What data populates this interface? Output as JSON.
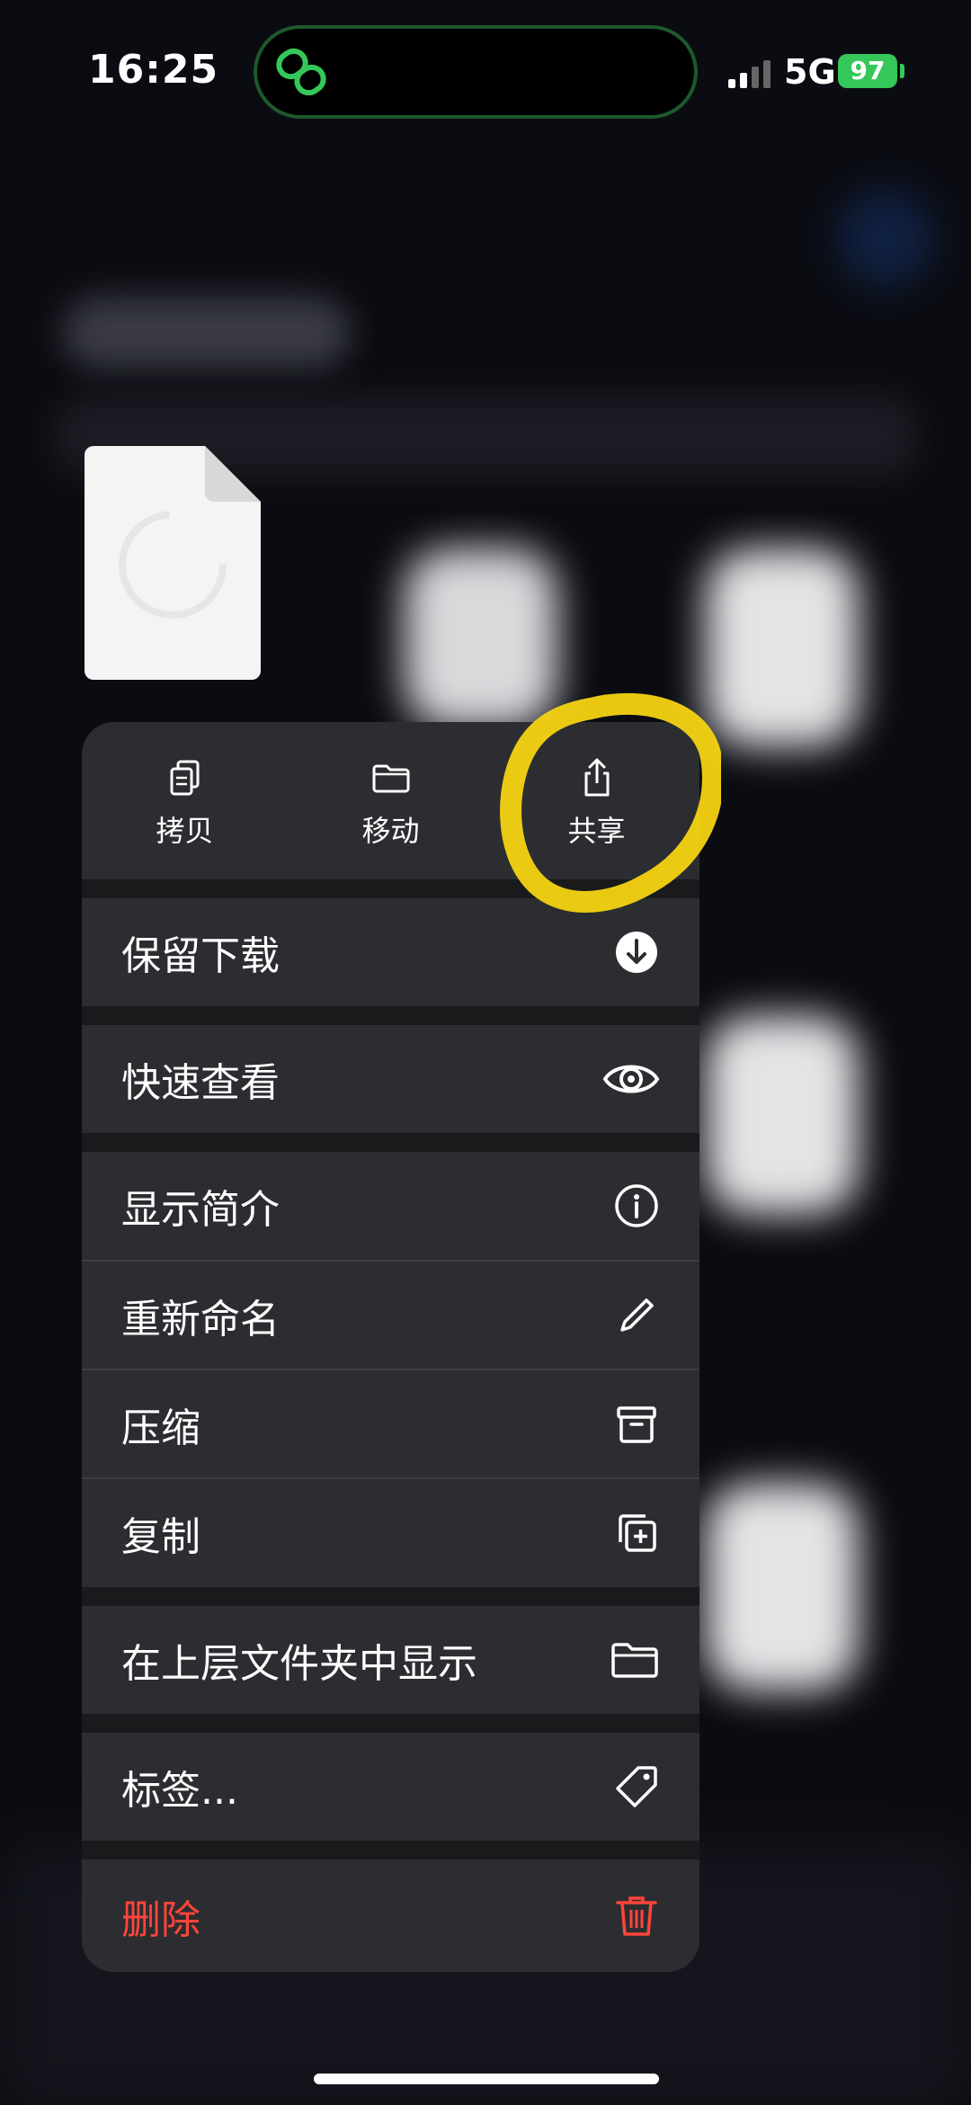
{
  "status_bar": {
    "time": "16:25",
    "network": "5G",
    "battery": "97"
  },
  "top_actions": [
    {
      "label": "拷贝",
      "icon": "copy-icon"
    },
    {
      "label": "移动",
      "icon": "folder-icon"
    },
    {
      "label": "共享",
      "icon": "share-icon"
    }
  ],
  "menu_items": [
    {
      "label": "保留下载",
      "icon": "download-circle-icon"
    },
    {
      "label": "快速查看",
      "icon": "eye-icon"
    },
    {
      "label": "显示简介",
      "icon": "info-icon"
    },
    {
      "label": "重新命名",
      "icon": "pencil-icon"
    },
    {
      "label": "压缩",
      "icon": "archive-icon"
    },
    {
      "label": "复制",
      "icon": "duplicate-icon"
    },
    {
      "label": "在上层文件夹中显示",
      "icon": "folder-icon"
    },
    {
      "label": "标签...",
      "icon": "tag-icon"
    },
    {
      "label": "删除",
      "icon": "trash-icon"
    }
  ],
  "colors": {
    "accent_green": "#35c759",
    "danger": "#ff453a",
    "annotation": "#f5d312"
  }
}
